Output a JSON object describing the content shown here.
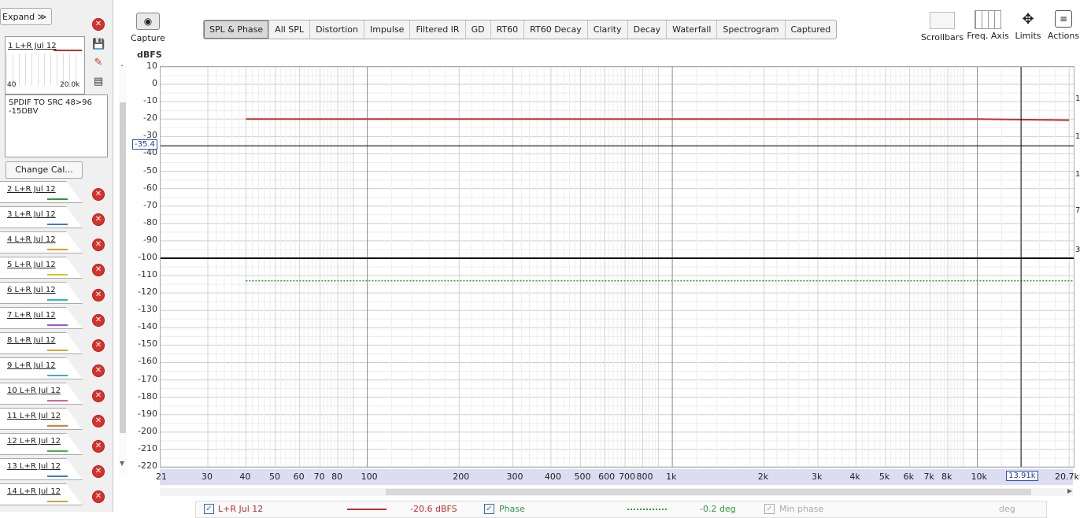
{
  "sidebar": {
    "expand_label": "Expand ≫",
    "first": {
      "name": "1 L+R Jul 12",
      "color": "#c0302b",
      "thumb_min": "40",
      "thumb_max": "20.0k",
      "notes": "SPDIF TO SRC 48>96\n-15DBV"
    },
    "change_cal_label": "Change Cal...",
    "items": [
      {
        "name": "2 L+R Jul 12",
        "color": "#2e9a3a"
      },
      {
        "name": "3 L+R Jul 12",
        "color": "#3b7ad9"
      },
      {
        "name": "4 L+R Jul 12",
        "color": "#e39a28"
      },
      {
        "name": "5 L+R Jul 12",
        "color": "#d8c928"
      },
      {
        "name": "6 L+R Jul 12",
        "color": "#2fb5c9"
      },
      {
        "name": "7 L+R Jul 12",
        "color": "#9a55d6"
      },
      {
        "name": "8 L+R Jul 12",
        "color": "#d8a33a"
      },
      {
        "name": "9 L+R Jul 12",
        "color": "#3da9e0"
      },
      {
        "name": "10 L+R Jul 12",
        "color": "#d95fa2"
      },
      {
        "name": "11 L+R Jul 12",
        "color": "#e07a3a"
      },
      {
        "name": "12 L+R Jul 12",
        "color": "#4bb04b"
      },
      {
        "name": "13 L+R Jul 12",
        "color": "#3a7ad9"
      },
      {
        "name": "14 L+R Jul 12",
        "color": "#c9a83a"
      }
    ]
  },
  "toolbar": {
    "capture_label": "Capture",
    "tabs": [
      "SPL & Phase",
      "All SPL",
      "Distortion",
      "Impulse",
      "Filtered IR",
      "GD",
      "RT60",
      "RT60 Decay",
      "Clarity",
      "Decay",
      "Waterfall",
      "Spectrogram",
      "Captured"
    ],
    "active_tab": "SPL & Phase",
    "right_tools": [
      "Scrollbars",
      "Freq. Axis",
      "Limits",
      "Actions"
    ]
  },
  "plot": {
    "y_unit": "dBFS",
    "y_ticks": [
      "10",
      "0",
      "-10",
      "-20",
      "-30",
      "-40",
      "-50",
      "-60",
      "-70",
      "-80",
      "-90",
      "-100",
      "-110",
      "-120",
      "-130",
      "-140",
      "-150",
      "-160",
      "-170",
      "-180",
      "-190",
      "-200",
      "-210",
      "-220"
    ],
    "y_cursor_label": "-35.4",
    "x_ticks": [
      "21",
      "30",
      "40",
      "50",
      "60",
      "70",
      "80",
      "100",
      "200",
      "300",
      "400",
      "500",
      "600",
      "700",
      "800",
      "1k",
      "2k",
      "3k",
      "4k",
      "5k",
      "6k",
      "7k",
      "8k",
      "10k",
      "13.91k",
      "20.7kHz"
    ],
    "x_cursor_label": "13.91k",
    "right_ticks": [
      "1",
      "1",
      "1",
      "7",
      "3"
    ]
  },
  "chart_data": {
    "type": "line",
    "x_scale": "log",
    "xlim": [
      21,
      20700
    ],
    "ylim": [
      -220,
      10
    ],
    "series": [
      {
        "color": "#c0302b",
        "x": [
          40,
          100,
          1000,
          10000,
          20000
        ],
        "y": [
          -20,
          -20,
          -20,
          -20,
          -20.6
        ]
      },
      {
        "color": "#111111",
        "x": [
          21,
          100,
          1000,
          10000,
          20700
        ],
        "y": [
          -100,
          -100,
          -100,
          -100,
          -100
        ]
      },
      {
        "color": "#2e9a3a",
        "x": [
          40,
          100,
          1000,
          10000,
          20700
        ],
        "y": [
          -113,
          -113,
          -113,
          -113,
          -113
        ]
      }
    ],
    "cursor": {
      "x": 13910,
      "y": -35.4
    }
  },
  "legend": {
    "trace_name": "L+R Jul 12",
    "trace_value": "-20.6 dBFS",
    "phase_label": "Phase",
    "phase_value": "-0.2 deg",
    "minphase_label": "Min phase",
    "minphase_unit": "deg"
  }
}
